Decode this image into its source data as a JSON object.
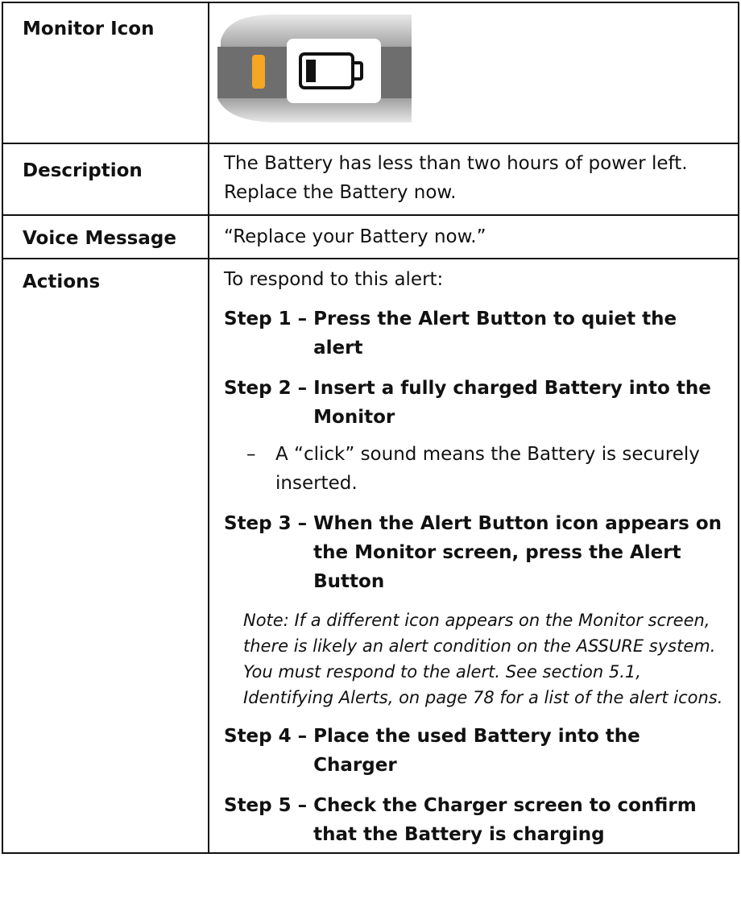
{
  "rows": {
    "icon": {
      "label": "Monitor Icon"
    },
    "description": {
      "label": "Description",
      "text": "The Battery has less than two hours of power left. Replace the Battery now."
    },
    "voice": {
      "label": "Voice Message",
      "text": "“Replace your Battery now.”"
    },
    "actions": {
      "label": "Actions",
      "intro": "To respond to this alert:",
      "steps": [
        {
          "num": "Step 1 – ",
          "text": "Press the Alert Button to quiet the alert"
        },
        {
          "num": "Step 2 – ",
          "text": "Insert a fully charged Battery into the Monitor"
        },
        {
          "num": "Step 3 – ",
          "text": "When the Alert Button icon appears on the Monitor screen, press the Alert Button"
        },
        {
          "num": "Step 4 – ",
          "text": "Place the used Battery into the Charger"
        },
        {
          "num": "Step 5 – ",
          "text": "Check the Charger screen to confirm that the Battery is charging"
        }
      ],
      "sub_bullet": {
        "dash": "–",
        "text": "A “click” sound means the Battery is securely inserted."
      },
      "note": "Note: If a different icon appears on the Monitor screen, there is likely an alert condition on the ASSURE system. You must respond to the alert. See section 5.1, Identifying Alerts, on page 78 for a list of the alert icons."
    }
  },
  "icon_image": {
    "name": "low-battery-icon",
    "indicator_color": "#F5A623",
    "body_color": "#6E6E6E",
    "screen_color": "#FFFFFF"
  }
}
